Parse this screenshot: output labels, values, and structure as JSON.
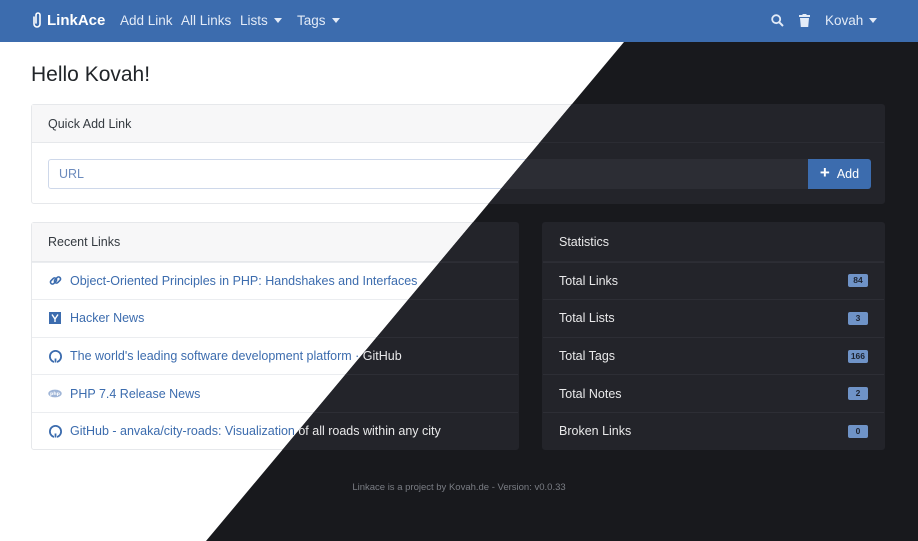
{
  "navbar": {
    "brand": "LinkAce",
    "items": [
      {
        "label": "Add Link"
      },
      {
        "label": "All Links"
      },
      {
        "label": "Lists"
      },
      {
        "label": "Tags"
      }
    ],
    "user": "Kovah"
  },
  "page": {
    "greeting": "Hello Kovah!"
  },
  "quick_add": {
    "header": "Quick Add Link",
    "url_placeholder": "URL",
    "add_label": "Add"
  },
  "recent_links": {
    "header": "Recent Links",
    "items": [
      {
        "title": "Object-Oriented Principles in PHP: Handshakes and Interfaces",
        "icon": "link-icon"
      },
      {
        "title": "Hacker News",
        "icon": "hacker-news-icon"
      },
      {
        "title": "The world's leading software development platform · GitHub",
        "icon": "github-icon"
      },
      {
        "title": "PHP 7.4 Release News",
        "icon": "php-icon"
      },
      {
        "title": "GitHub - anvaka/city-roads: Visualization of all roads within any city",
        "icon": "github-icon"
      }
    ]
  },
  "statistics": {
    "header": "Statistics",
    "items": [
      {
        "label": "Total Links",
        "count": "84"
      },
      {
        "label": "Total Lists",
        "count": "3"
      },
      {
        "label": "Total Tags",
        "count": "166"
      },
      {
        "label": "Total Notes",
        "count": "2"
      },
      {
        "label": "Broken Links",
        "count": "0"
      }
    ]
  },
  "footer": {
    "text": "Linkace is a project by Kovah.de - Version: v0.0.33"
  },
  "colors": {
    "primary": "#3c6cae",
    "dark_bg": "#18191d",
    "dark_card": "#23242a"
  }
}
